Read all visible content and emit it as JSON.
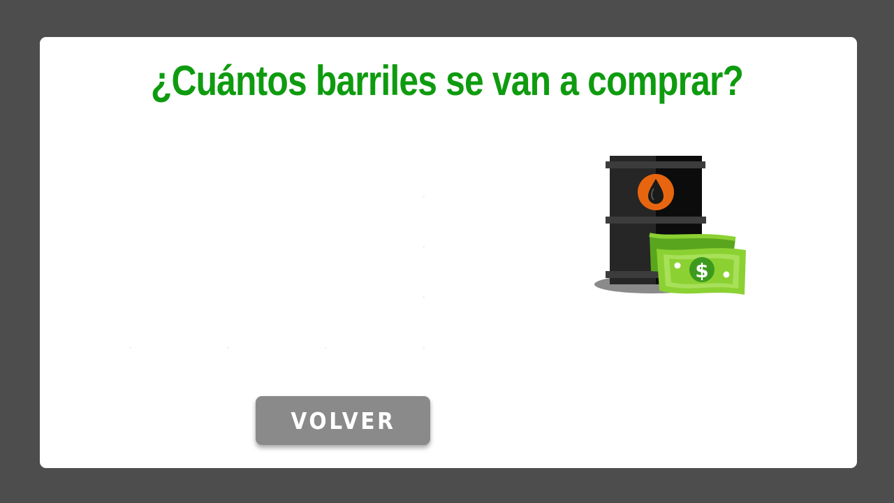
{
  "question": {
    "title": "¿Cuántos barriles se van a comprar?"
  },
  "answer_options": [],
  "actions": {
    "back_label": "VOLVER"
  },
  "illustration": {
    "subject": "oil-barrel-with-dollar-bills-icon",
    "currency_symbol": "$"
  },
  "colors": {
    "background": "#4d4d4d",
    "card": "#ffffff",
    "title": "#0f9b0f",
    "button": "#8a8a8a",
    "barrel": "#1e1e1e",
    "oil_drop": "#e8650f",
    "money": "#8cd132"
  }
}
